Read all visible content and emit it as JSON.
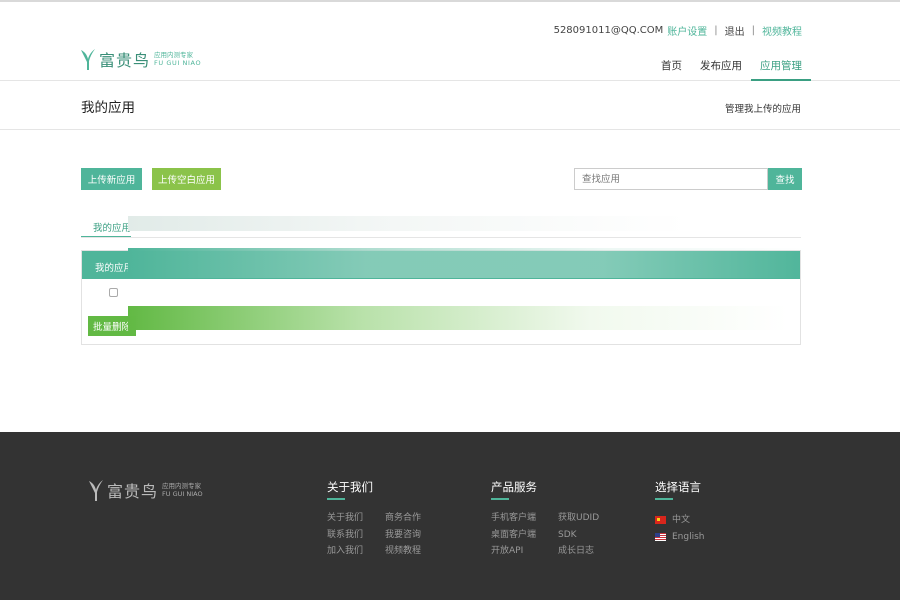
{
  "header": {
    "account": "528091011@QQ.COM",
    "links": [
      "账户设置",
      "退出",
      "视频教程"
    ],
    "separator": "|",
    "logo_name": "富贵鸟",
    "logo_tagline": "应用内测专家",
    "logo_en": "FU GUI NIAO",
    "nav": [
      "首页",
      "发布应用",
      "应用管理"
    ],
    "nav_active": "应用管理"
  },
  "titlebar": {
    "title": "我的应用",
    "description": "管理我上传的应用"
  },
  "toolbar": {
    "upload_label": "上传新应用",
    "blank_label": "上传空白应用",
    "search_placeholder": "查找应用",
    "search_button": "查找"
  },
  "tabs": [
    "我的应用"
  ],
  "panel": {
    "header": "我的应用",
    "batch_delete": "批量删除"
  },
  "footer": {
    "logo_name": "富贵鸟",
    "logo_tagline": "应用内测专家",
    "logo_en": "FU GUI NIAO",
    "about": {
      "title": "关于我们",
      "links": [
        "关于我们",
        "商务合作",
        "联系我们",
        "我要咨询",
        "加入我们",
        "视频教程"
      ]
    },
    "products": {
      "title": "产品服务",
      "links": [
        "手机客户端",
        "获取UDID",
        "桌面客户端",
        "SDK",
        "开放API",
        "成长日志"
      ]
    },
    "language": {
      "title": "选择语言",
      "options": [
        "中文",
        "English"
      ]
    }
  },
  "colors": {
    "accent": "#4fb59a",
    "accent_dark": "#3a9f82",
    "lime": "#8bc34a",
    "footer_bg": "#333333"
  }
}
